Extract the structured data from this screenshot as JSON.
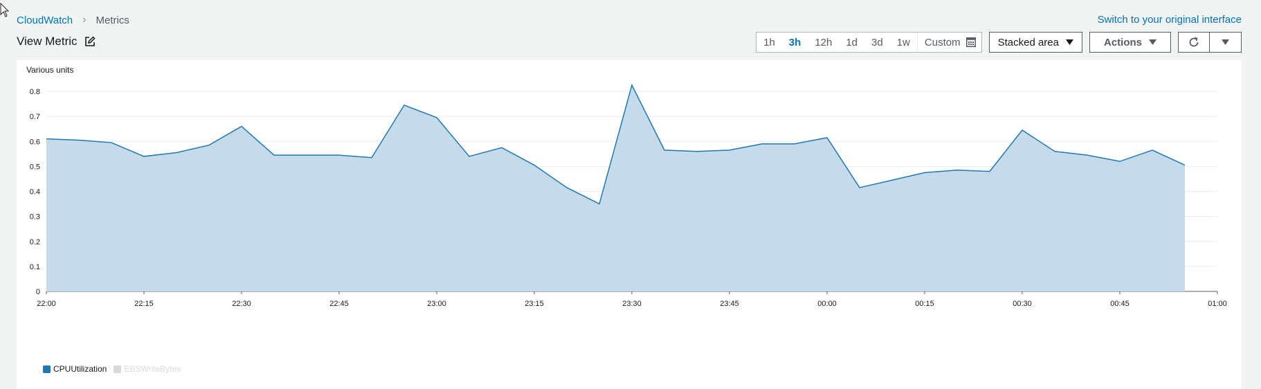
{
  "breadcrumb": {
    "root": "CloudWatch",
    "current": "Metrics"
  },
  "header": {
    "switch_link": "Switch to your original interface",
    "title": "View Metric"
  },
  "toolbar": {
    "ranges": [
      "1h",
      "3h",
      "12h",
      "1d",
      "3d",
      "1w"
    ],
    "active_range": "3h",
    "custom_label": "Custom",
    "view_select": "Stacked area",
    "actions_label": "Actions"
  },
  "colors": {
    "accent": "#0073bb",
    "series": "#1f77b4",
    "fill": "#c6dbea",
    "inactive": "#d5dbdb"
  },
  "chart_data": {
    "type": "area",
    "ylabel": "Various units",
    "ylim": [
      0,
      0.8
    ],
    "yticks": [
      "0",
      "0.1",
      "0.2",
      "0.3",
      "0.4",
      "0.5",
      "0.6",
      "0.7",
      "0.8"
    ],
    "x_ticks": [
      "22:00",
      "22:15",
      "22:30",
      "22:45",
      "23:00",
      "23:15",
      "23:30",
      "23:45",
      "00:00",
      "00:15",
      "00:30",
      "00:45",
      "01:00"
    ],
    "x_range_minutes": [
      0,
      180
    ],
    "grid": true,
    "legend_position": "bottom-left",
    "series": [
      {
        "name": "CPUUtilization",
        "active": true,
        "x_minutes": [
          0,
          5,
          10,
          15,
          20,
          25,
          30,
          35,
          40,
          45,
          50,
          55,
          60,
          65,
          70,
          75,
          80,
          85,
          90,
          95,
          100,
          105,
          110,
          115,
          120,
          125,
          130,
          135,
          140,
          145,
          150,
          155,
          160,
          165,
          170,
          175
        ],
        "values": [
          0.61,
          0.605,
          0.595,
          0.54,
          0.555,
          0.585,
          0.66,
          0.545,
          0.545,
          0.545,
          0.535,
          0.745,
          0.695,
          0.54,
          0.575,
          0.505,
          0.415,
          0.35,
          0.825,
          0.565,
          0.56,
          0.565,
          0.59,
          0.59,
          0.615,
          0.415,
          0.445,
          0.475,
          0.485,
          0.48,
          0.645,
          0.56,
          0.545,
          0.52,
          0.565,
          0.505
        ]
      },
      {
        "name": "EBSWriteBytes",
        "active": false
      }
    ]
  }
}
